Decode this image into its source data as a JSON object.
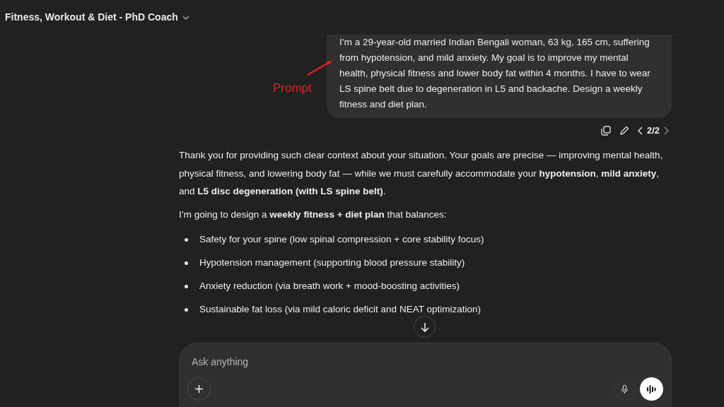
{
  "header": {
    "title": "Fitness, Workout & Diet - PhD Coach"
  },
  "annotation": {
    "label": "Prompt"
  },
  "user_message": {
    "text": "I’m a 29-year-old married Indian Bengali woman, 63 kg, 165 cm, suffering from hypotension, and mild anxiety. My goal is to improve my mental health, physical fitness and lower body fat within 4 months. I have to wear LS spine belt due to degeneration in L5 and backache. Design a weekly fitness and diet plan.",
    "pager": "2/2"
  },
  "response": {
    "paragraphs": [
      "Thank you for providing such clear context about your situation. Your goals are precise — improving mental health, physical fitness, and lowering body fat — while we must carefully accommodate your **hypotension**, **mild anxiety**, and **L5 disc degeneration (with LS spine belt)**.",
      "I’m going to design a **weekly fitness + diet plan** that balances:"
    ],
    "bullets": [
      "Safety for your spine (low spinal compression + core stability focus)",
      "Hypotension management (supporting blood pressure stability)",
      "Anxiety reduction (via breath work + mood-boosting activities)",
      "Sustainable fat loss (via mild caloric deficit and NEAT optimization)"
    ]
  },
  "composer": {
    "placeholder": "Ask anything"
  }
}
